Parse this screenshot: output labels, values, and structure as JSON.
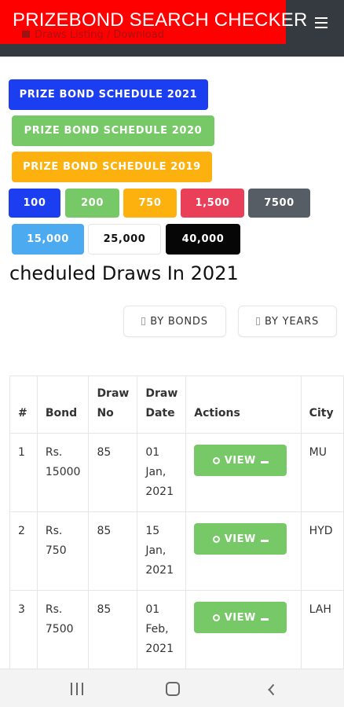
{
  "header": {
    "title": "PRIZEBOND SEARCH CHECKER",
    "breadcrumb": "Draws Listing / Download"
  },
  "schedule_buttons": [
    {
      "label": "PRIZE BOND SCHEDULE 2021",
      "color": "#1a3ef0"
    },
    {
      "label": "PRIZE BOND SCHEDULE 2020",
      "color": "#77c967"
    },
    {
      "label": "PRIZE BOND SCHEDULE 2019",
      "color": "#fdb10f"
    }
  ],
  "denomination_buttons": [
    {
      "label": "100",
      "color": "#1a3ef0"
    },
    {
      "label": "200",
      "color": "#77c967"
    },
    {
      "label": "750",
      "color": "#fdb10f"
    },
    {
      "label": "1,500",
      "color": "#ea3f59"
    },
    {
      "label": "7500",
      "color": "#575d64"
    },
    {
      "label": "15,000",
      "color": "#4baaf0"
    },
    {
      "label": "25,000",
      "color": "#ffffff"
    },
    {
      "label": "40,000",
      "color": "#060606"
    }
  ],
  "main": {
    "heading": "cheduled Draws In 2021",
    "filter_bonds": "BY BONDS",
    "filter_years": "BY YEARS"
  },
  "table": {
    "columns": [
      "#",
      "Bond",
      "Draw No",
      "Draw Date",
      "Actions",
      "City"
    ],
    "rows": [
      {
        "num": "1",
        "bond": "Rs. 15000",
        "draw_no": "85",
        "date": "01 Jan, 2021",
        "action": "VIEW",
        "city": "MU"
      },
      {
        "num": "2",
        "bond": "Rs. 750",
        "draw_no": "85",
        "date": "15 Jan, 2021",
        "action": "VIEW",
        "city": "HYD"
      },
      {
        "num": "3",
        "bond": "Rs. 7500",
        "draw_no": "85",
        "date": "01 Feb, 2021",
        "action": "VIEW",
        "city": "LAH"
      }
    ]
  },
  "icons": {
    "menu": "hamburger-icon",
    "home": "home-icon",
    "search": "search-icon",
    "download": "download-icon"
  }
}
